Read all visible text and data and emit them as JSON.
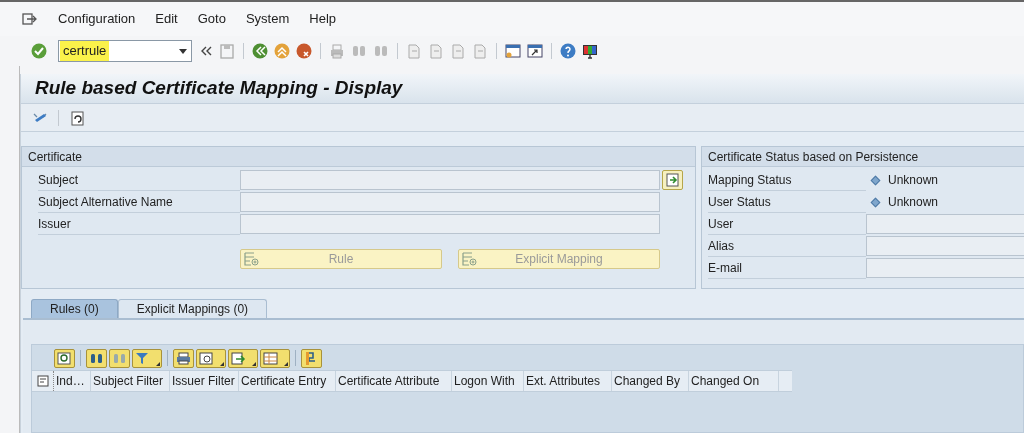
{
  "menu": [
    {
      "label": "Configuration"
    },
    {
      "label": "Edit"
    },
    {
      "label": "Goto"
    },
    {
      "label": "System"
    },
    {
      "label": "Help"
    }
  ],
  "command_field": {
    "value": "certrule"
  },
  "title": "Rule based Certificate Mapping - Display",
  "certificate": {
    "title": "Certificate",
    "fields": [
      {
        "label": "Subject"
      },
      {
        "label": "Subject Alternative Name"
      },
      {
        "label": "Issuer"
      }
    ],
    "buttons": [
      {
        "label": "Rule",
        "disabled": true
      },
      {
        "label": "Explicit Mapping",
        "disabled": true
      }
    ]
  },
  "status": {
    "title": "Certificate Status based on Persistence",
    "rows": [
      {
        "kind": "status",
        "label": "Mapping Status",
        "value": "Unknown"
      },
      {
        "kind": "status",
        "label": "User Status",
        "value": "Unknown"
      },
      {
        "kind": "field",
        "label": "User"
      },
      {
        "kind": "field",
        "label": "Alias"
      },
      {
        "kind": "field",
        "label": "E-mail"
      }
    ]
  },
  "tabs": [
    {
      "label": "Rules (0)",
      "selected": true
    },
    {
      "label": "Explicit Mappings (0)",
      "selected": false
    }
  ],
  "table": {
    "columns": [
      "Ind…",
      "Subject Filter",
      "Issuer Filter",
      "Certificate Entry",
      "Certificate Attribute",
      "Logon With",
      "Ext. Attributes",
      "Changed By",
      "Changed On"
    ]
  }
}
